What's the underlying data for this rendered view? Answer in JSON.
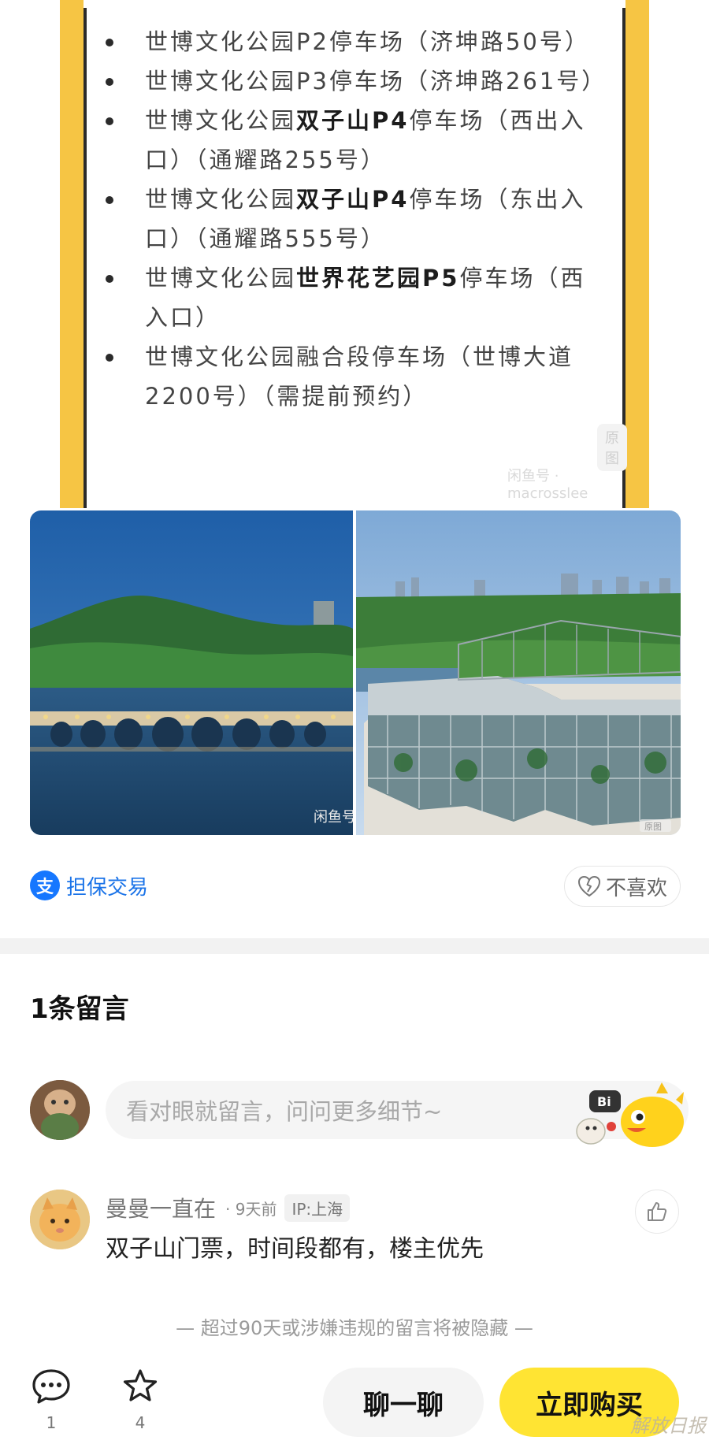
{
  "parking": {
    "items": [
      {
        "prefix": "世博文化公园P2停车场（济坤路50号）",
        "bold": "",
        "suffix": ""
      },
      {
        "prefix": "世博文化公园P3停车场（济坤路261号）",
        "bold": "",
        "suffix": ""
      },
      {
        "prefix": "世博文化公园",
        "bold": "双子山P4",
        "suffix": "停车场（西出入口）（通耀路255号）"
      },
      {
        "prefix": "世博文化公园",
        "bold": "双子山P4",
        "suffix": "停车场（东出入口）（通耀路555号）"
      },
      {
        "prefix": "世博文化公园",
        "bold": "世界花艺园P5",
        "suffix": "停车场（西入口）"
      },
      {
        "prefix": "世博文化公园融合段停车场（世博大道2200号）（需提前预约）",
        "bold": "",
        "suffix": ""
      }
    ],
    "watermark_badge": "原图",
    "watermark_text": "闲鱼号 · macrosslee"
  },
  "photos": {
    "left_watermark": "闲鱼号",
    "right_watermark": "原图"
  },
  "trade": {
    "icon_glyph": "支",
    "label": "担保交易",
    "dislike_label": "不喜欢"
  },
  "comments": {
    "title": "1条留言",
    "input_placeholder": "看对眼就留言，问问更多细节~",
    "mascot_badge": "Bi",
    "items": [
      {
        "user": "曼曼一直在",
        "time": "· 9天前",
        "ip": "IP:上海",
        "text": "双子山门票，时间段都有，楼主优先"
      }
    ],
    "hidden_note": "— 超过90天或涉嫌违规的留言将被隐藏 —"
  },
  "bottom_bar": {
    "comment_count": "1",
    "favorite_count": "4",
    "chat_label": "聊一聊",
    "buy_label": "立即购买",
    "corner_logo": "解放日报"
  },
  "colors": {
    "accent_yellow": "#ffe433",
    "card_border": "#f6c544",
    "link_blue": "#1a73e8"
  }
}
